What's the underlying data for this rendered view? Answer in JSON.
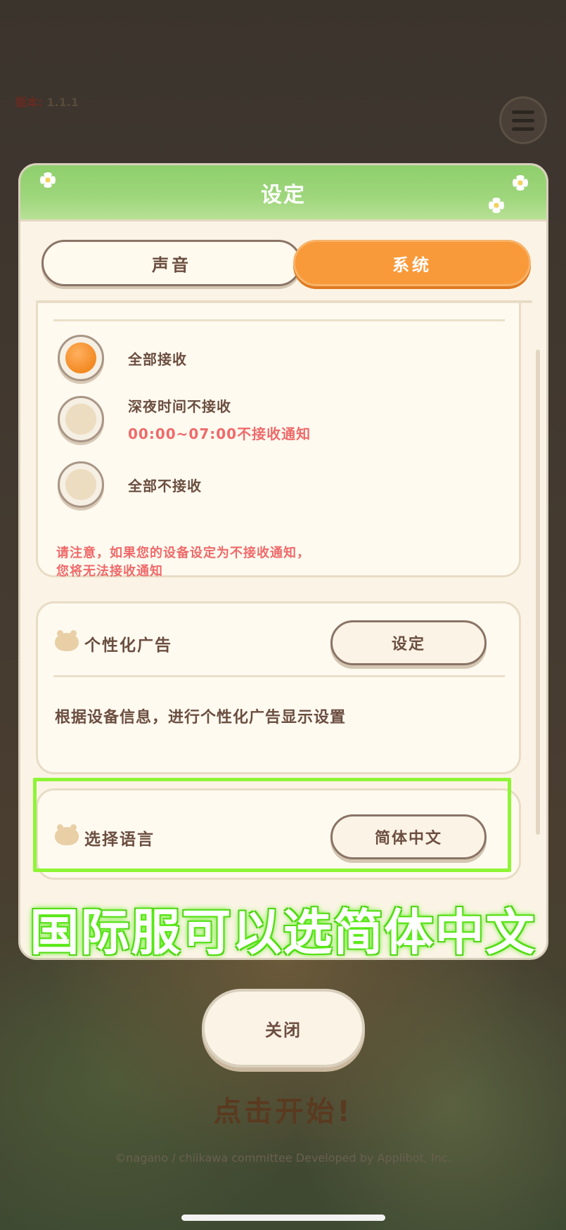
{
  "app": {
    "version_label": "版本:",
    "version_value": "1.1.1",
    "start_hint": "点击开始!",
    "copyright": "©nagano / chiikawa committee   Developed by Applibot, Inc."
  },
  "modal": {
    "title": "设定",
    "tabs": [
      {
        "label": "声音",
        "active": false
      },
      {
        "label": "系统",
        "active": true
      }
    ],
    "notifications": {
      "options": [
        {
          "label": "全部接收",
          "selected": true,
          "sub": ""
        },
        {
          "label": "深夜时间不接收",
          "selected": false,
          "sub": "00:00~07:00不接收通知"
        },
        {
          "label": "全部不接收",
          "selected": false,
          "sub": ""
        }
      ],
      "note_line1": "请注意，如果您的设备设定为不接收通知，",
      "note_line2": "您将无法接收通知"
    },
    "ads": {
      "title": "个性化广告",
      "button": "设定",
      "description": "根据设备信息，进行个性化广告显示设置"
    },
    "language": {
      "title": "选择语言",
      "selected": "简体中文"
    },
    "close_label": "关闭"
  },
  "overlay": {
    "caption": "国际服可以选简体中文",
    "highlight_color": "#8ef535"
  },
  "colors": {
    "header_green": "#9fd67c",
    "accent_orange": "#f99a3a",
    "text_brown": "#6b4e40",
    "warning_red": "#ef6a6a"
  }
}
